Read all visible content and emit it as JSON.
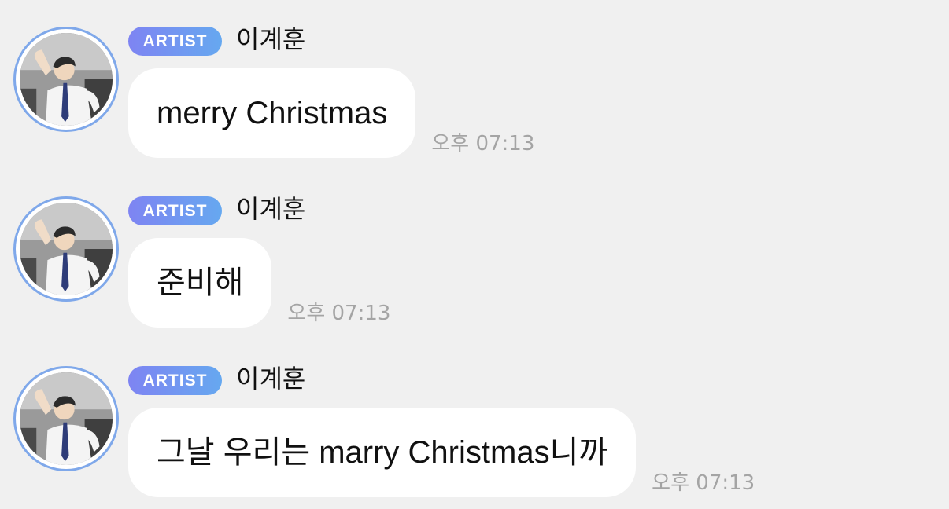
{
  "chat": {
    "messages": [
      {
        "badge": "ARTIST",
        "sender": "이계훈",
        "text": "merry Christmas",
        "time": "오후 07:13",
        "avatar_icon": "profile-photo"
      },
      {
        "badge": "ARTIST",
        "sender": "이계훈",
        "text": "준비해",
        "time": "오후 07:13",
        "avatar_icon": "profile-photo"
      },
      {
        "badge": "ARTIST",
        "sender": "이계훈",
        "text": "그날 우리는 marry Christmas니까",
        "time": "오후 07:13",
        "avatar_icon": "profile-photo"
      }
    ]
  },
  "colors": {
    "background": "#f0f0f0",
    "bubble": "#ffffff",
    "badge_start": "#7e84f2",
    "badge_end": "#66a8f0",
    "avatar_ring": "#7fa8ea",
    "timestamp": "#a4a4a4"
  }
}
